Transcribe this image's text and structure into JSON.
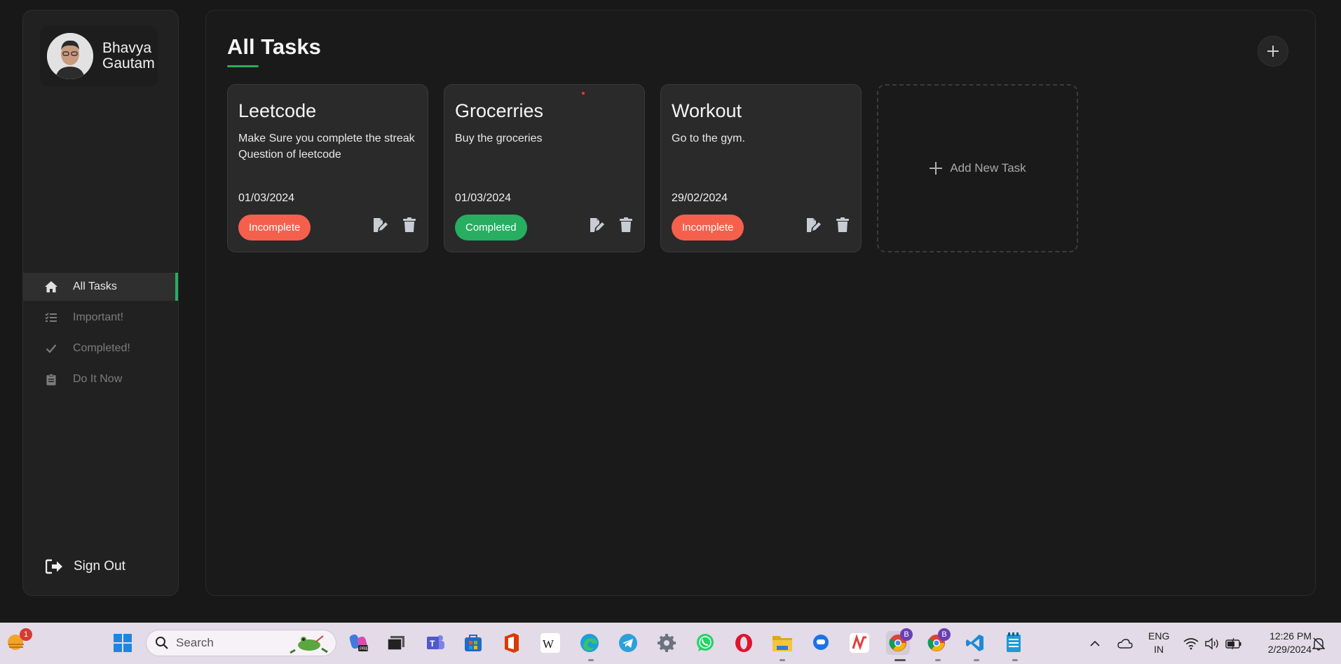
{
  "user": {
    "name_line1": "Bhavya",
    "name_line2": "Gautam"
  },
  "nav": {
    "items": [
      {
        "label": "All Tasks",
        "icon": "home-icon",
        "active": true
      },
      {
        "label": "Important!",
        "icon": "list-check-icon",
        "active": false
      },
      {
        "label": "Completed!",
        "icon": "check-icon",
        "active": false
      },
      {
        "label": "Do It Now",
        "icon": "clipboard-icon",
        "active": false
      }
    ],
    "signout_label": "Sign Out"
  },
  "main": {
    "title": "All Tasks",
    "add_new_label": "Add New Task"
  },
  "tasks": [
    {
      "title": "Leetcode",
      "description": "Make Sure you complete the streak Question of leetcode",
      "date": "01/03/2024",
      "status": "Incomplete"
    },
    {
      "title": "Grocerries",
      "description": "Buy the groceries",
      "date": "01/03/2024",
      "status": "Completed"
    },
    {
      "title": "Workout",
      "description": "Go to the gym.",
      "date": "29/02/2024",
      "status": "Incomplete"
    }
  ],
  "colors": {
    "accent": "#27ae60",
    "incomplete": "#f5604d",
    "completed": "#27ae60",
    "background": "#181818",
    "card": "#2a2a2a"
  },
  "taskbar": {
    "search_placeholder": "Search",
    "notification_count": "1",
    "lang_line1": "ENG",
    "lang_line2": "IN",
    "time": "12:26 PM",
    "date": "2/29/2024",
    "profile_badge": "B"
  }
}
